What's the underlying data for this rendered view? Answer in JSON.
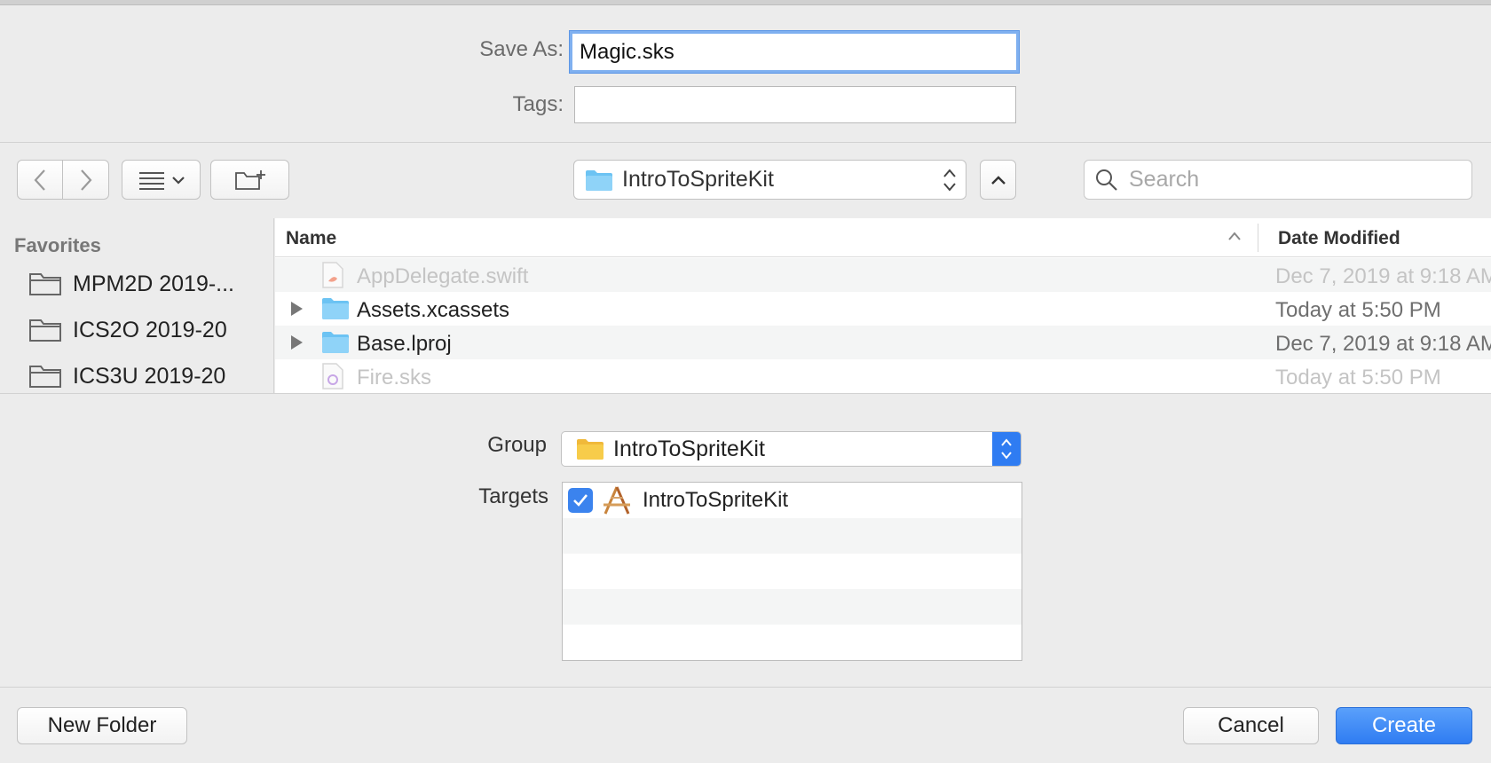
{
  "save_as": {
    "label": "Save As:",
    "value": "Magic.sks"
  },
  "tags": {
    "label": "Tags:",
    "value": ""
  },
  "toolbar": {
    "location": "IntroToSpriteKit",
    "search_placeholder": "Search"
  },
  "sidebar": {
    "heading": "Favorites",
    "items": [
      {
        "label": "MPM2D 2019-..."
      },
      {
        "label": "ICS2O 2019-20"
      },
      {
        "label": "ICS3U 2019-20"
      }
    ]
  },
  "file_list": {
    "columns": {
      "name": "Name",
      "date": "Date Modified"
    },
    "rows": [
      {
        "name": "AppDelegate.swift",
        "date": "Dec 7, 2019 at 9:18 AM",
        "enabled": false,
        "kind": "swift-file-icon"
      },
      {
        "name": "Assets.xcassets",
        "date": "Today at 5:50 PM",
        "enabled": true,
        "kind": "folder-icon"
      },
      {
        "name": "Base.lproj",
        "date": "Dec 7, 2019 at 9:18 AM",
        "enabled": true,
        "kind": "folder-icon"
      },
      {
        "name": "Fire.sks",
        "date": "Today at 5:50 PM",
        "enabled": false,
        "kind": "particle-file-icon"
      }
    ]
  },
  "group": {
    "label": "Group",
    "value": "IntroToSpriteKit"
  },
  "targets": {
    "label": "Targets",
    "items": [
      {
        "name": "IntroToSpriteKit",
        "checked": true
      }
    ]
  },
  "buttons": {
    "new_folder": "New Folder",
    "cancel": "Cancel",
    "create": "Create"
  },
  "colors": {
    "accent": "#2f7cf2",
    "folder_blue": "#6cc3f3",
    "folder_yellow": "#f7cc4a"
  }
}
